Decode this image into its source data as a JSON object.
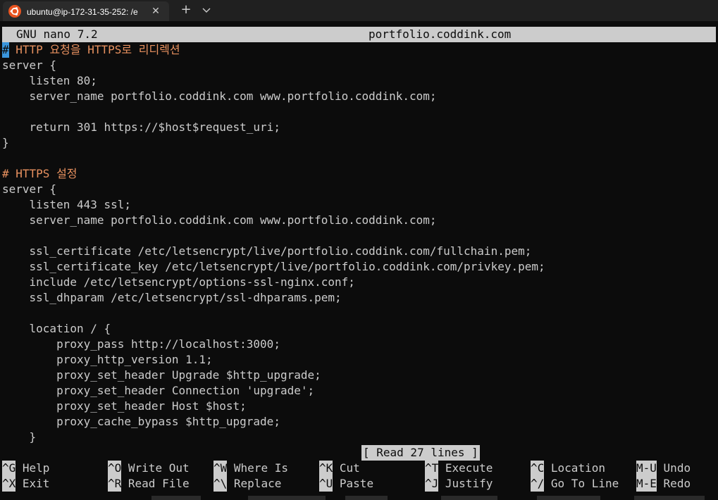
{
  "tab": {
    "icon": "ubuntu-icon",
    "title": "ubuntu@ip-172-31-35-252: /e",
    "close_glyph": "✕",
    "new_tab_glyph": "+",
    "dropdown_icon": "chevron-down-icon"
  },
  "nano": {
    "version": "GNU nano 7.2",
    "filename": "portfolio.coddink.com",
    "status": "[ Read 27 lines ]"
  },
  "editor": {
    "lines": [
      {
        "text": "# HTTP 요청을 HTTPS로 리디렉션",
        "type": "comment"
      },
      {
        "text": "server {",
        "type": "code"
      },
      {
        "text": "    listen 80;",
        "type": "code"
      },
      {
        "text": "    server_name portfolio.coddink.com www.portfolio.coddink.com;",
        "type": "code"
      },
      {
        "text": "",
        "type": "code"
      },
      {
        "text": "    return 301 https://$host$request_uri;",
        "type": "code"
      },
      {
        "text": "}",
        "type": "code"
      },
      {
        "text": "",
        "type": "code"
      },
      {
        "text": "# HTTPS 설정",
        "type": "comment"
      },
      {
        "text": "server {",
        "type": "code"
      },
      {
        "text": "    listen 443 ssl;",
        "type": "code"
      },
      {
        "text": "    server_name portfolio.coddink.com www.portfolio.coddink.com;",
        "type": "code"
      },
      {
        "text": "",
        "type": "code"
      },
      {
        "text": "    ssl_certificate /etc/letsencrypt/live/portfolio.coddink.com/fullchain.pem;",
        "type": "code"
      },
      {
        "text": "    ssl_certificate_key /etc/letsencrypt/live/portfolio.coddink.com/privkey.pem;",
        "type": "code"
      },
      {
        "text": "    include /etc/letsencrypt/options-ssl-nginx.conf;",
        "type": "code"
      },
      {
        "text": "    ssl_dhparam /etc/letsencrypt/ssl-dhparams.pem;",
        "type": "code"
      },
      {
        "text": "",
        "type": "code"
      },
      {
        "text": "    location / {",
        "type": "code"
      },
      {
        "text": "        proxy_pass http://localhost:3000;",
        "type": "code"
      },
      {
        "text": "        proxy_http_version 1.1;",
        "type": "code"
      },
      {
        "text": "        proxy_set_header Upgrade $http_upgrade;",
        "type": "code"
      },
      {
        "text": "        proxy_set_header Connection 'upgrade';",
        "type": "code"
      },
      {
        "text": "        proxy_set_header Host $host;",
        "type": "code"
      },
      {
        "text": "        proxy_cache_bypass $http_upgrade;",
        "type": "code"
      },
      {
        "text": "    }",
        "type": "code"
      }
    ]
  },
  "shortcuts": [
    {
      "key": "^G",
      "label": "Help"
    },
    {
      "key": "^O",
      "label": "Write Out"
    },
    {
      "key": "^W",
      "label": "Where Is"
    },
    {
      "key": "^K",
      "label": "Cut"
    },
    {
      "key": "^T",
      "label": "Execute"
    },
    {
      "key": "^C",
      "label": "Location"
    },
    {
      "key": "M-U",
      "label": "Undo"
    },
    {
      "key": "^X",
      "label": "Exit"
    },
    {
      "key": "^R",
      "label": "Read File"
    },
    {
      "key": "^\\",
      "label": "Replace"
    },
    {
      "key": "^U",
      "label": "Paste"
    },
    {
      "key": "^J",
      "label": "Justify"
    },
    {
      "key": "^/",
      "label": "Go To Line"
    },
    {
      "key": "M-E",
      "label": "Redo"
    }
  ],
  "colors": {
    "background": "#0c0c0c",
    "foreground": "#cccccc",
    "comment": "#e8915f",
    "cursor": "#3a96dd",
    "ubuntu_orange": "#e95420"
  }
}
